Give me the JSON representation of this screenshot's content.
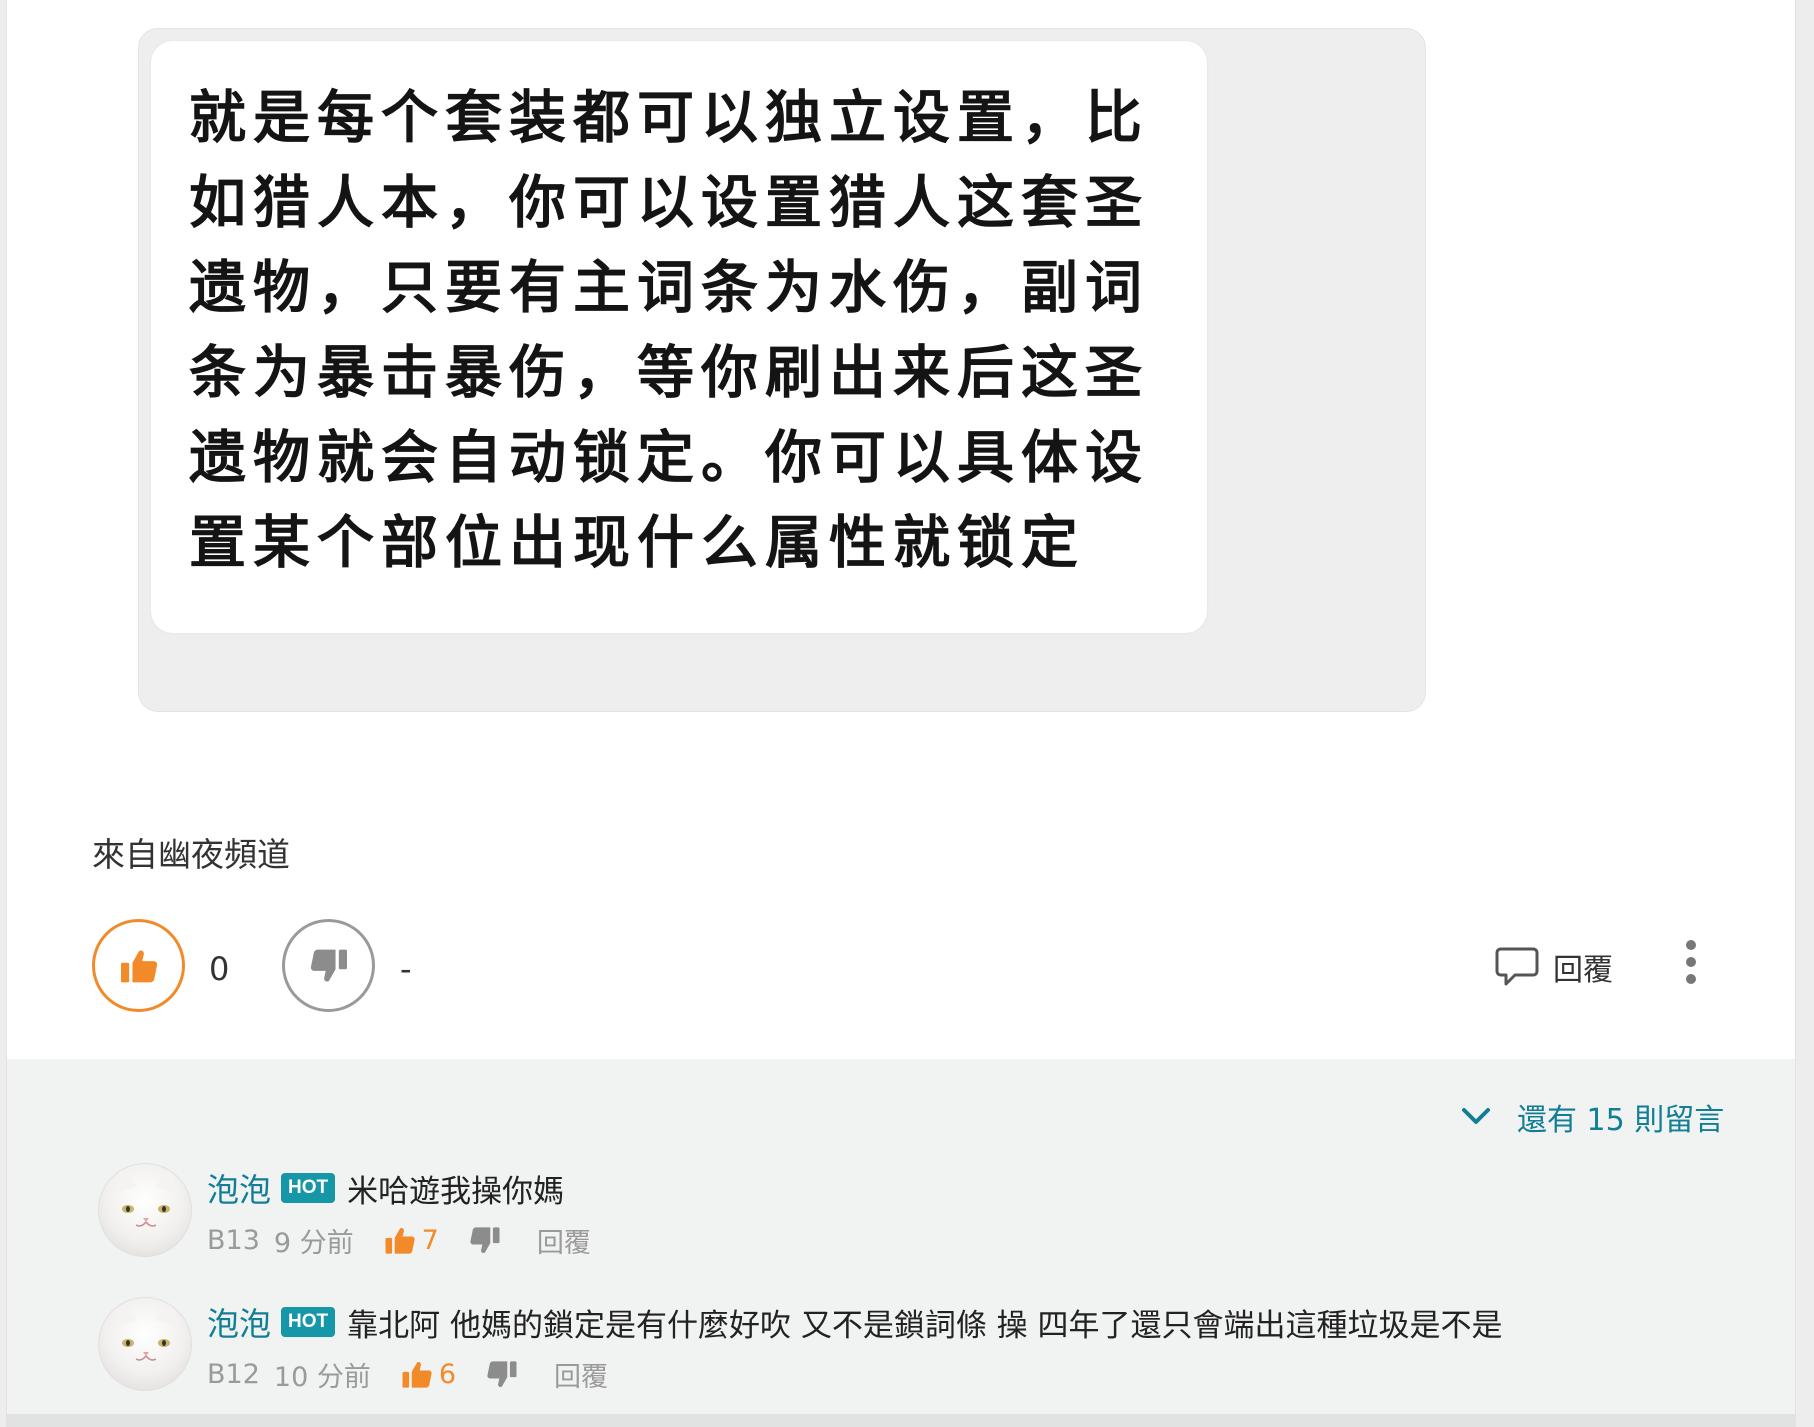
{
  "post": {
    "image_text_lines": [
      "就是每个套装都可以独立设置，比",
      "如猎人本，你可以设置猎人这套圣",
      "遗物，只要有主词条为水伤，副词",
      "条为暴击暴伤，等你刷出来后这圣",
      "遗物就会自动锁定。你可以具体设",
      "置某个部位出现什么属性就锁定"
    ],
    "source": "來自幽夜頻道"
  },
  "actions": {
    "like_count": "0",
    "dislike_count": "-",
    "reply_label": "回覆"
  },
  "comments": {
    "more_label": "還有 15 則留言",
    "items": [
      {
        "user": "泡泡",
        "badge": "HOT",
        "text": "米哈遊我操你媽",
        "floor": "B13",
        "time": "9 分前",
        "likes": "7",
        "reply": "回覆"
      },
      {
        "user": "泡泡",
        "badge": "HOT",
        "text": "靠北阿 他媽的鎖定是有什麼好吹 又不是鎖詞條 操 四年了還只會端出這種垃圾是不是",
        "floor": "B12",
        "time": "10 分前",
        "likes": "6",
        "reply": "回覆"
      }
    ]
  },
  "colors": {
    "accent_orange": "#f28a2a",
    "link_teal": "#117e96",
    "hot_badge": "#1697a7"
  },
  "icons": [
    "thumbs-up-icon",
    "thumbs-down-icon",
    "comment-bubble-icon",
    "more-vertical-icon",
    "chevron-down-icon",
    "cat-avatar"
  ]
}
